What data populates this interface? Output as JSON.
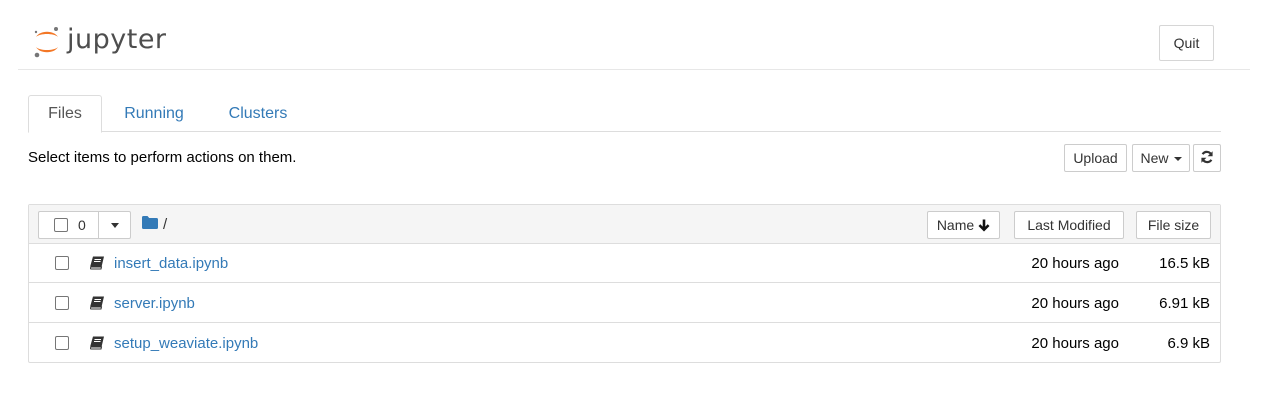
{
  "header": {
    "logo_text": "jupyter",
    "quit_label": "Quit"
  },
  "tabs": [
    {
      "label": "Files",
      "active": true
    },
    {
      "label": "Running",
      "active": false
    },
    {
      "label": "Clusters",
      "active": false
    }
  ],
  "toolbar": {
    "hint": "Select items to perform actions on them.",
    "upload_label": "Upload",
    "new_label": "New"
  },
  "list": {
    "selected_count": "0",
    "breadcrumb": "/",
    "columns": {
      "name": "Name",
      "modified": "Last Modified",
      "size": "File size"
    },
    "items": [
      {
        "name": "insert_data.ipynb",
        "modified": "20 hours ago",
        "size": "16.5 kB"
      },
      {
        "name": "server.ipynb",
        "modified": "20 hours ago",
        "size": "6.91 kB"
      },
      {
        "name": "setup_weaviate.ipynb",
        "modified": "20 hours ago",
        "size": "6.9 kB"
      }
    ]
  },
  "colors": {
    "link": "#337ab7",
    "logo_orange": "#f37726",
    "logo_gray": "#767677",
    "folder": "#337ab7"
  },
  "icons": {
    "logo": "jupyter-logo-icon",
    "folder": "folder-icon",
    "sort": "arrow-down-icon",
    "refresh": "refresh-icon",
    "notebook": "notebook-icon"
  }
}
